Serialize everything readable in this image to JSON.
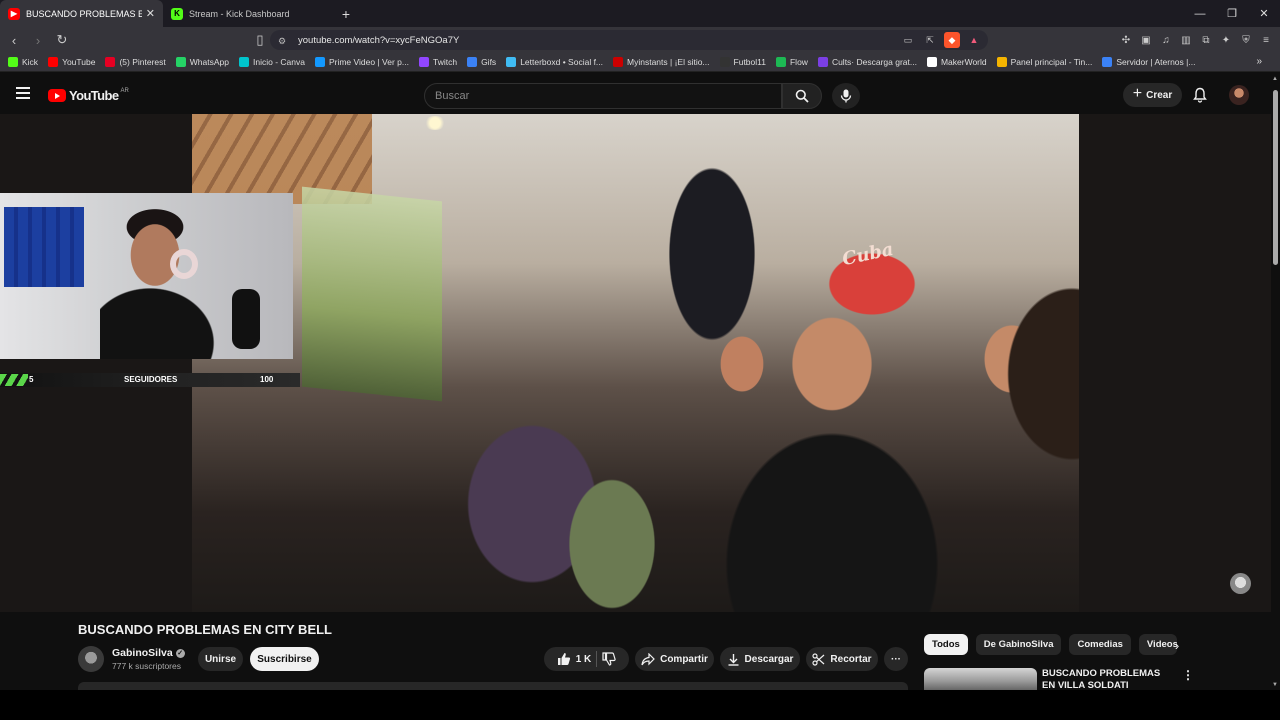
{
  "browser": {
    "tabs": [
      {
        "title": "BUSCANDO PROBLEMAS EN CIT",
        "icon": "youtube-icon",
        "active": true
      },
      {
        "title": "Stream - Kick Dashboard",
        "icon": "kick-icon",
        "active": false
      }
    ],
    "new_tab": "+",
    "url": "youtube.com/watch?v=xycFeNGOa7Y",
    "bookmarks": [
      {
        "label": "Kick",
        "color": "#53fc18"
      },
      {
        "label": "YouTube",
        "color": "#ff0000"
      },
      {
        "label": "(5) Pinterest",
        "color": "#e60023"
      },
      {
        "label": "WhatsApp",
        "color": "#25d366"
      },
      {
        "label": "Inicio - Canva",
        "color": "#00c4cc"
      },
      {
        "label": "Prime Video | Ver p...",
        "color": "#1399ff"
      },
      {
        "label": "Twitch",
        "color": "#9146ff"
      },
      {
        "label": "Gifs",
        "color": "#3b82f6"
      },
      {
        "label": "Letterboxd • Social f...",
        "color": "#40bcf4"
      },
      {
        "label": "Myinstants | ¡El sitio...",
        "color": "#cc0000"
      },
      {
        "label": "Futbol11",
        "color": "#333333"
      },
      {
        "label": "Flow",
        "color": "#1db954"
      },
      {
        "label": "Cults· Descarga grat...",
        "color": "#7b3fe4"
      },
      {
        "label": "MakerWorld",
        "color": "#ffffff"
      },
      {
        "label": "Panel principal - Tin...",
        "color": "#f5b400"
      },
      {
        "label": "Servidor | Aternos |...",
        "color": "#3b82f6"
      }
    ]
  },
  "yt_header": {
    "logo": "YouTube",
    "country": "AR",
    "search_placeholder": "Buscar",
    "create_label": "Crear"
  },
  "overlay": {
    "followers_current": "5",
    "followers_label": "SEGUIDORES",
    "followers_goal": "100"
  },
  "video": {
    "cap_text": "Cuba",
    "title": "BUSCANDO PROBLEMAS EN CITY BELL",
    "channel": "GabinoSilva",
    "subscribers": "777 k suscriptores",
    "join_label": "Unirse",
    "subscribe_label": "Suscribirse",
    "likes": "1 K",
    "share_label": "Compartir",
    "download_label": "Descargar",
    "clip_label": "Recortar",
    "more_label": "···"
  },
  "recommendations": {
    "chips": [
      "Todos",
      "De GabinoSilva",
      "Comedias",
      "Videos"
    ],
    "first_title": "BUSCANDO PROBLEMAS EN VILLA SOLDATI"
  },
  "colors": {
    "youtube_red": "#ff0000",
    "kick_green": "#53fc18",
    "bg": "#0f0f0f"
  }
}
